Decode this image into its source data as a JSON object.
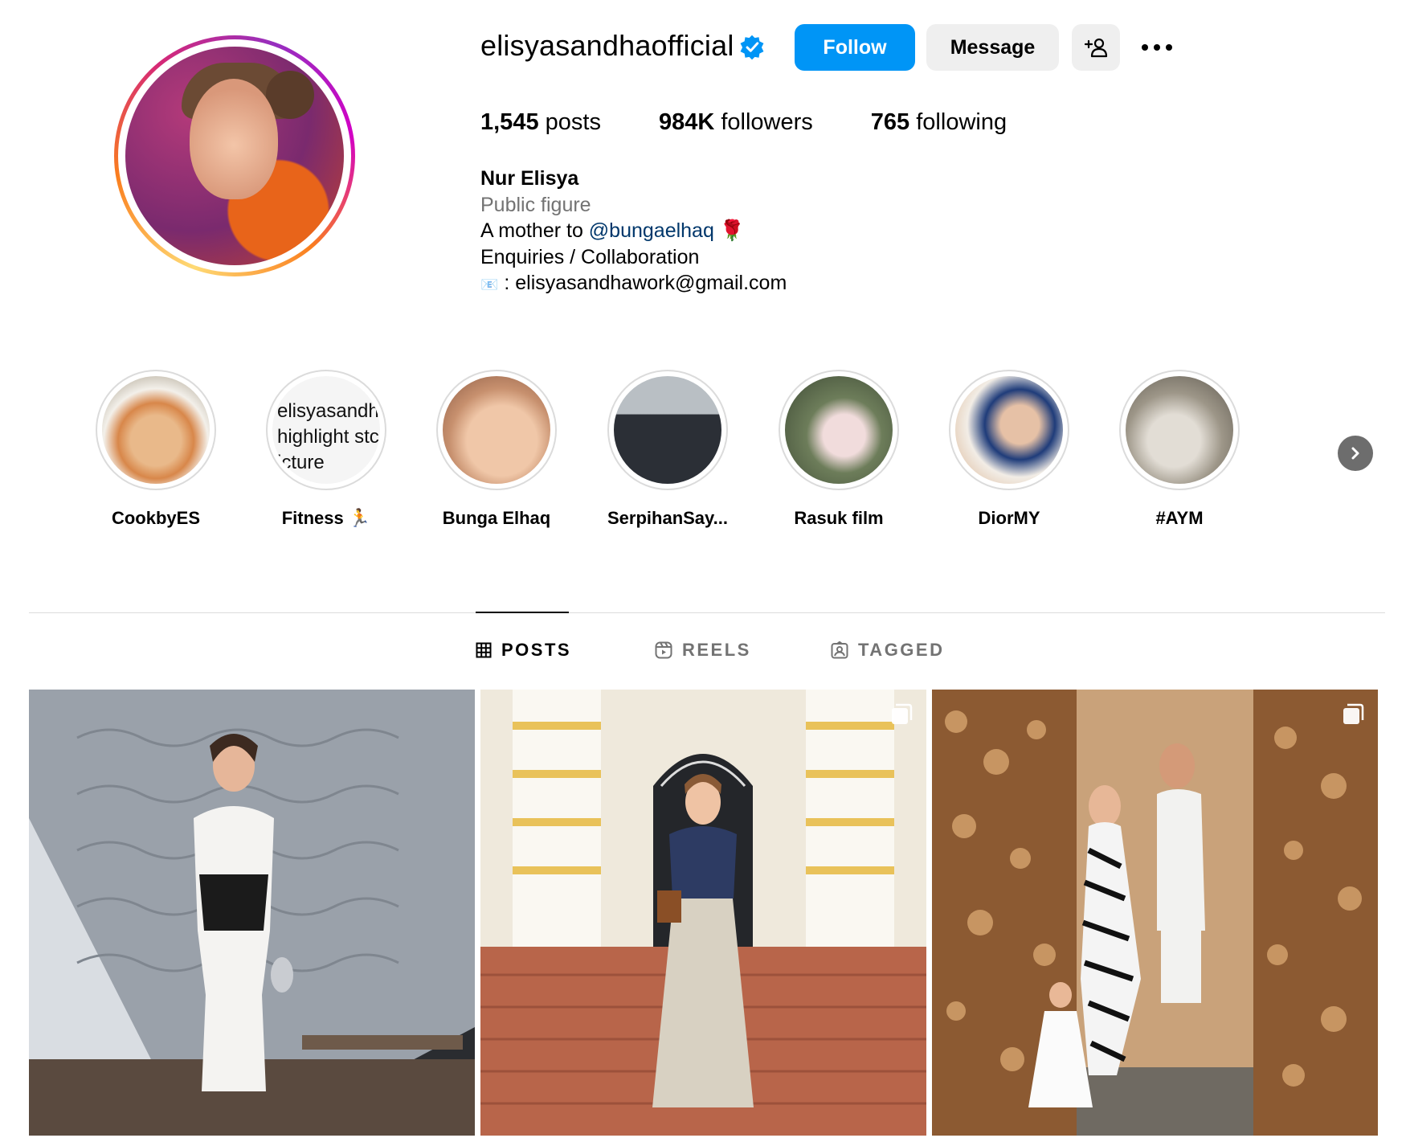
{
  "profile": {
    "username": "elisyasandhaofficial",
    "verified": true,
    "follow_label": "Follow",
    "message_label": "Message",
    "suggest_icon": "person-add-icon",
    "more_icon": "more-dots-icon"
  },
  "stats": {
    "posts_count": "1,545",
    "posts_label": "posts",
    "followers_count": "984K",
    "followers_label": "followers",
    "following_count": "765",
    "following_label": "following"
  },
  "bio": {
    "name": "Nur Elisya",
    "category": "Public figure",
    "line1_prefix": "A mother to ",
    "mention": "@bungaelhaq",
    "line1_emoji": "🌹",
    "line2": "Enquiries / Collaboration",
    "line3_icon": "📧",
    "line3": " : elisyasandhawork@gmail.com"
  },
  "highlights": [
    {
      "label": "CookbyES"
    },
    {
      "label": "Fitness 🏃",
      "broken_alt": [
        "elisyasandh",
        "highlight stc",
        "icture"
      ]
    },
    {
      "label": "Bunga Elhaq"
    },
    {
      "label": "SerpihanSay..."
    },
    {
      "label": "Rasuk film"
    },
    {
      "label": "DiorMY"
    },
    {
      "label": "#AYM"
    }
  ],
  "tabs": [
    {
      "label": "POSTS",
      "icon": "grid-icon",
      "active": true
    },
    {
      "label": "REELS",
      "icon": "reels-icon",
      "active": false
    },
    {
      "label": "TAGGED",
      "icon": "tagged-icon",
      "active": false
    }
  ],
  "posts": [
    {
      "multi": false
    },
    {
      "multi": true
    },
    {
      "multi": true
    }
  ],
  "colors": {
    "follow_blue": "#0095f6",
    "secondary_button": "#efefef",
    "muted_text": "#737373",
    "mention_link": "#00376b",
    "verified_blue": "#0095f6"
  }
}
